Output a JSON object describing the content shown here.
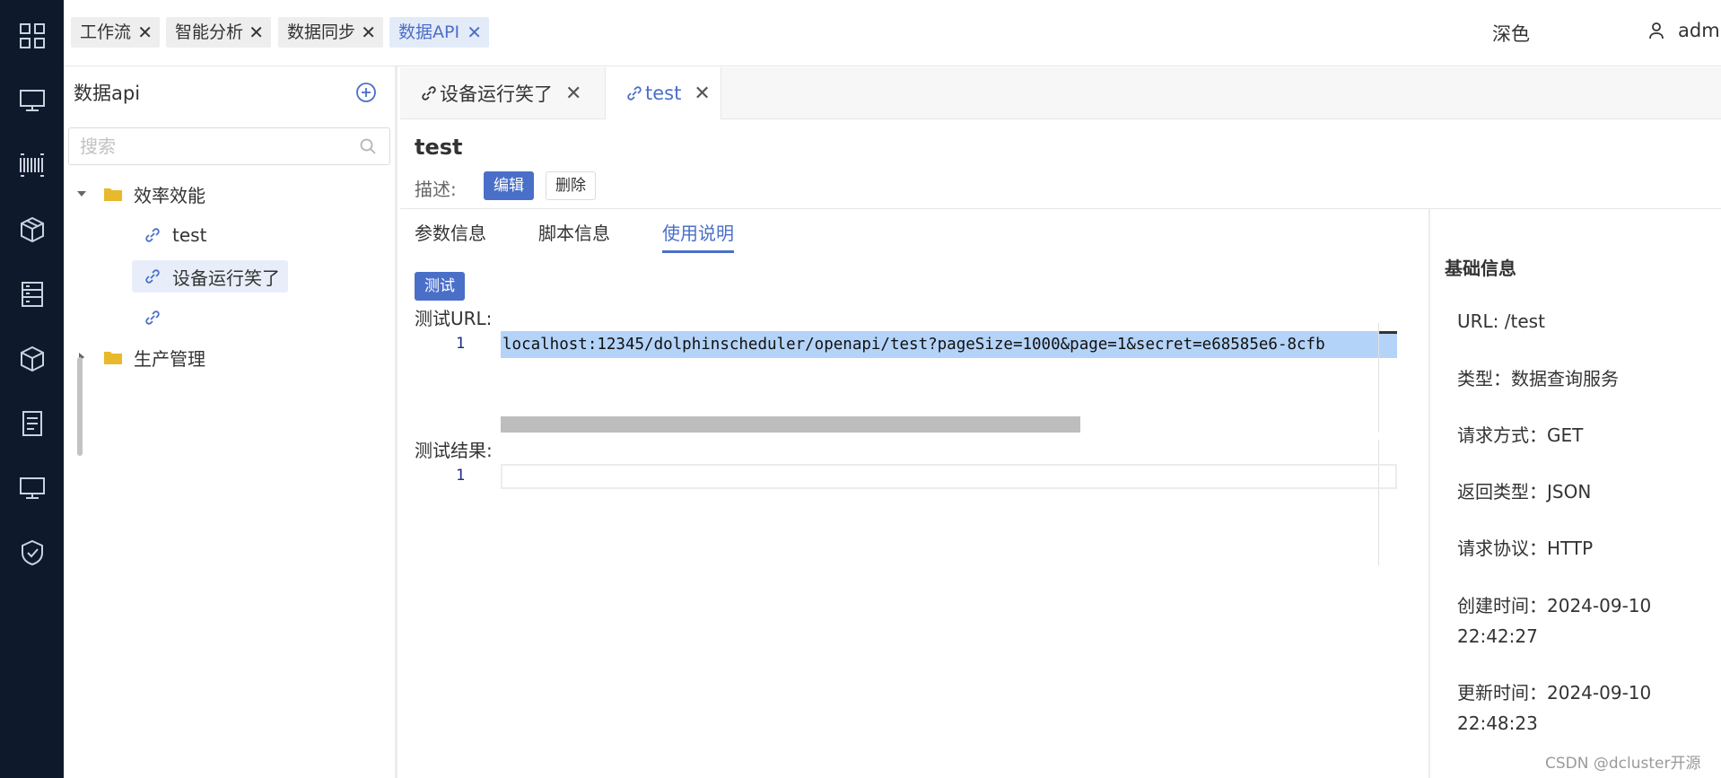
{
  "top_tabs": [
    {
      "label": "工作流",
      "active": false
    },
    {
      "label": "智能分析",
      "active": false
    },
    {
      "label": "数据同步",
      "active": false
    },
    {
      "label": "数据API",
      "active": true
    }
  ],
  "header": {
    "theme_label": "深色",
    "user_name": "admin"
  },
  "rail_icons": [
    "grid-icon",
    "monitor-icon",
    "barcode-icon",
    "cube-icon",
    "server-icon",
    "box-icon",
    "document-icon",
    "display-icon",
    "shield-check-icon"
  ],
  "tree": {
    "title": "数据api",
    "search_placeholder": "搜索",
    "nodes": [
      {
        "label": "效率效能",
        "type": "folder",
        "expanded": true
      },
      {
        "label": "test",
        "type": "api"
      },
      {
        "label": "设备运行笑了",
        "type": "api",
        "selected": true
      },
      {
        "label": "",
        "type": "api"
      },
      {
        "label": "生产管理",
        "type": "folder",
        "expanded": false
      }
    ]
  },
  "editor_tabs": [
    {
      "label": "设备运行笑了",
      "active": false
    },
    {
      "label": "test",
      "active": true
    }
  ],
  "api": {
    "name": "test",
    "desc_label": "描述:",
    "edit_label": "编辑",
    "delete_label": "删除"
  },
  "subtabs": [
    {
      "label": "参数信息",
      "active": false
    },
    {
      "label": "脚本信息",
      "active": false
    },
    {
      "label": "使用说明",
      "active": true
    }
  ],
  "usage": {
    "test_button": "测试",
    "url_label": "测试URL:",
    "url_line_no": "1",
    "url_value": "localhost:12345/dolphinscheduler/openapi/test?pageSize=1000&page=1&secret=e68585e6-8cfb",
    "result_label": "测试结果:",
    "result_line_no": "1"
  },
  "info": {
    "title": "基础信息",
    "url": "URL: /test",
    "type": "类型：数据查询服务",
    "method": "请求方式：GET",
    "return_type": "返回类型：JSON",
    "protocol": "请求协议：HTTP",
    "created_line1": "创建时间：2024-09-10",
    "created_line2": "22:42:27",
    "updated_line1": "更新时间：2024-09-10",
    "updated_line2": "22:48:23"
  },
  "watermark": "CSDN @dcluster开源",
  "colors": {
    "accent": "#4a6fc8",
    "rail_bg": "#0e1a2b",
    "folder": "#e8b92c",
    "selection": "#b4d3f8"
  }
}
